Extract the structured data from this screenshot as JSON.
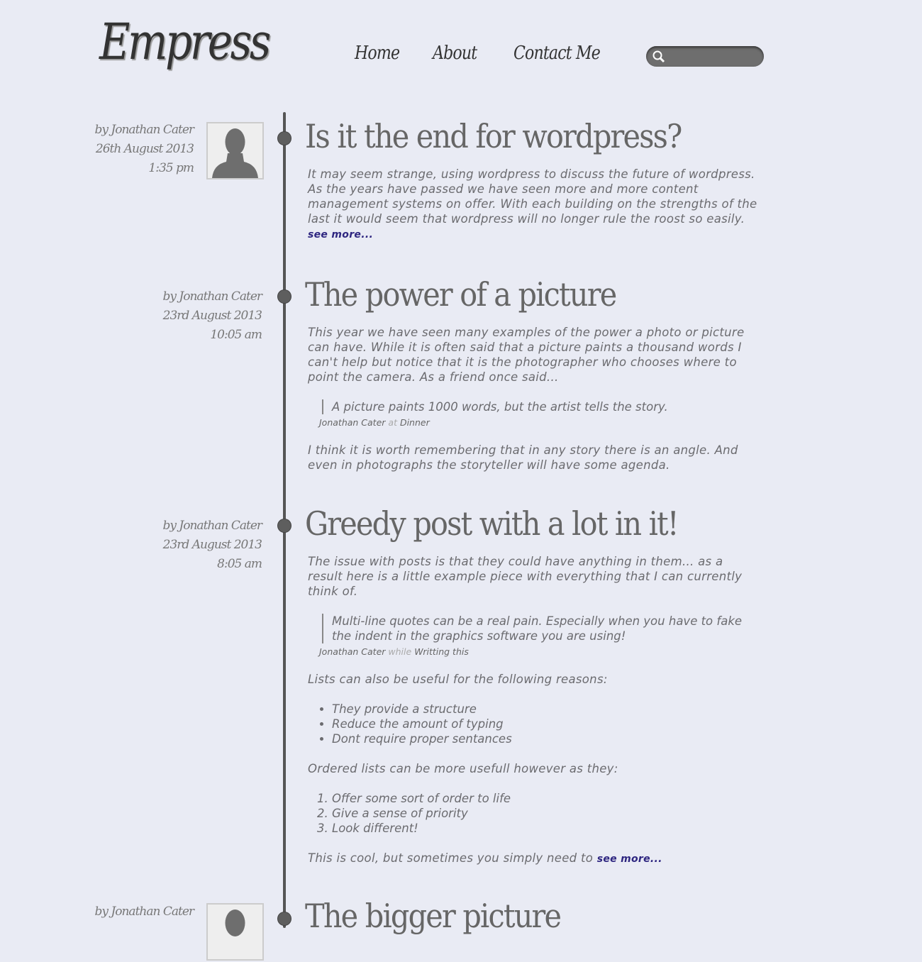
{
  "site": {
    "logo": "Empress"
  },
  "nav": [
    {
      "label": "Home"
    },
    {
      "label": "About"
    },
    {
      "label": "Contact Me"
    }
  ],
  "search": {
    "placeholder": "",
    "icon": "search-icon"
  },
  "posts": [
    {
      "author": "by Jonathan Cater",
      "date": "26th August 2013",
      "time": "1:35 pm",
      "title": "Is it the end for wordpress?",
      "p1": "It may seem strange, using wordpress to discuss the future of wordpress. As the years have passed we have seen more and more content management systems on offer. With each building on the strengths of the last it would seem that wordpress will no longer rule the roost so easily.",
      "more": "see more..."
    },
    {
      "author": "by Jonathan Cater",
      "date": "23rd August 2013",
      "time": "10:05 am",
      "title": "The power of a picture",
      "p1": "This year we have seen many examples of the power a photo or picture can have. While it is often said that a picture paints a thousand words I can't help but notice that it is the photographer who chooses where to point the camera. As a friend once said...",
      "quote": "A picture paints 1000 words, but the artist tells the story.",
      "cite_name": "Jonathan Cater",
      "cite_link": "at",
      "cite_place": "Dinner",
      "p2": "I think it is worth remembering that in any story there is an angle. And even in photographs the storyteller will have some agenda."
    },
    {
      "author": "by Jonathan Cater",
      "date": "23rd August 2013",
      "time": "8:05 am",
      "title": "Greedy post with a lot in it!",
      "p1": "The issue with posts is that they could have anything in them... as a result here is a little example piece with everything that I can currently think of.",
      "quote": "Multi-line quotes can be a real pain. Especially when you have to fake the indent in the graphics software you are using!",
      "cite_name": "Jonathan Cater",
      "cite_link": "while",
      "cite_place": "Writting this",
      "p2": "Lists can also be useful for the following reasons:",
      "ul": [
        "They provide a structure",
        "Reduce the amount of typing",
        "Dont require proper sentances"
      ],
      "p3": "Ordered lists can be more usefull however as they:",
      "ol": [
        "Offer some sort of order to life",
        "Give a sense of priority",
        "Look different!"
      ],
      "p4": "This is cool, but sometimes you simply need to",
      "more": "see more..."
    },
    {
      "author": "by Jonathan Cater",
      "title": "The bigger picture"
    }
  ]
}
